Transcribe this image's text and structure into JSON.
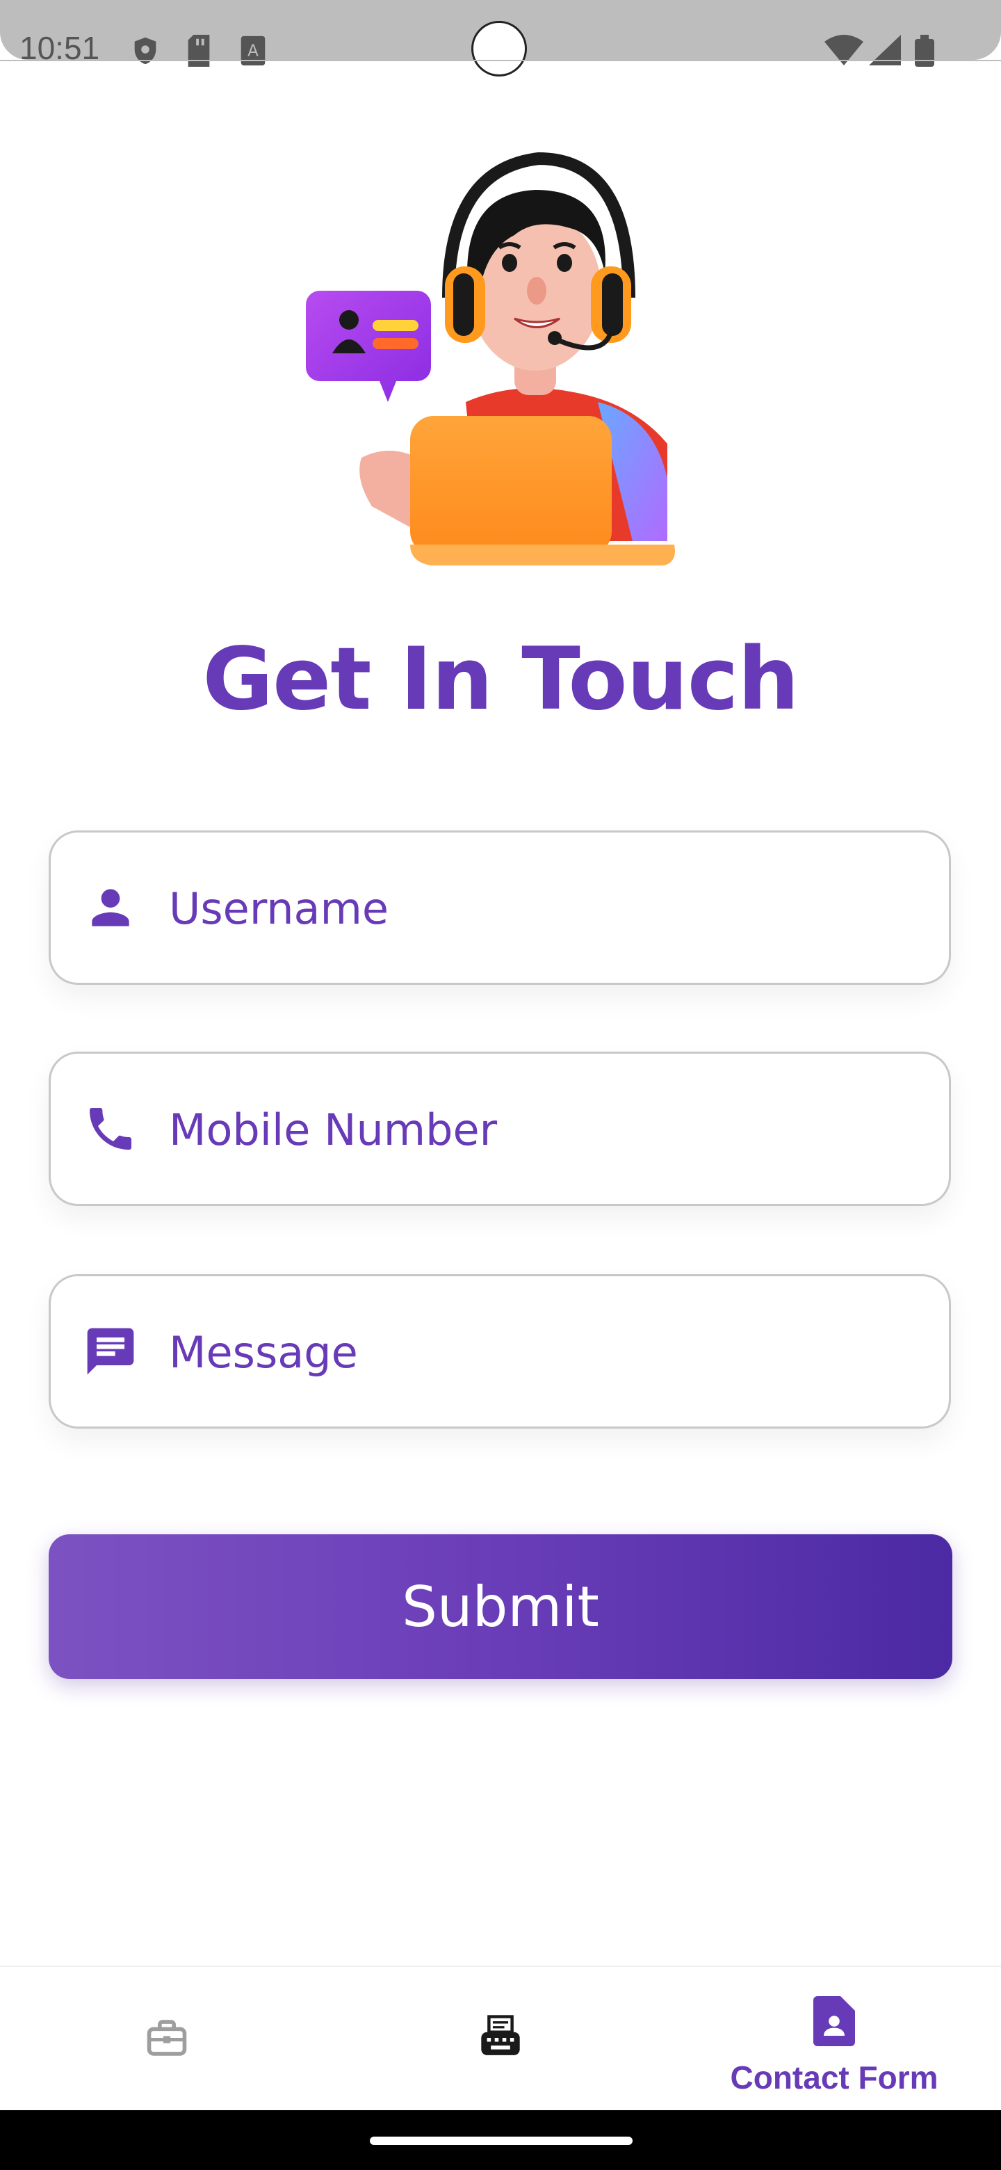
{
  "status_bar": {
    "time": "10:51",
    "left_icons": [
      "shield-icon",
      "sd-card-icon",
      "font-a-icon"
    ],
    "right_icons": [
      "wifi-icon",
      "signal-icon",
      "battery-icon"
    ]
  },
  "hero": {
    "icon": "support-agent-illustration"
  },
  "page": {
    "title": "Get In Touch"
  },
  "form": {
    "username_placeholder": "Username",
    "mobile_placeholder": "Mobile Number",
    "message_placeholder": "Message",
    "submit_label": "Submit"
  },
  "bottom_nav": {
    "items": [
      {
        "icon": "briefcase-icon",
        "label": "",
        "active": false
      },
      {
        "icon": "typewriter-icon",
        "label": "",
        "active": false
      },
      {
        "icon": "contact-form-icon",
        "label": "Contact Form",
        "active": true
      }
    ]
  },
  "colors": {
    "accent": "#673ab7",
    "gradient_start": "#7c52c2",
    "gradient_end": "#4b2aa3"
  }
}
